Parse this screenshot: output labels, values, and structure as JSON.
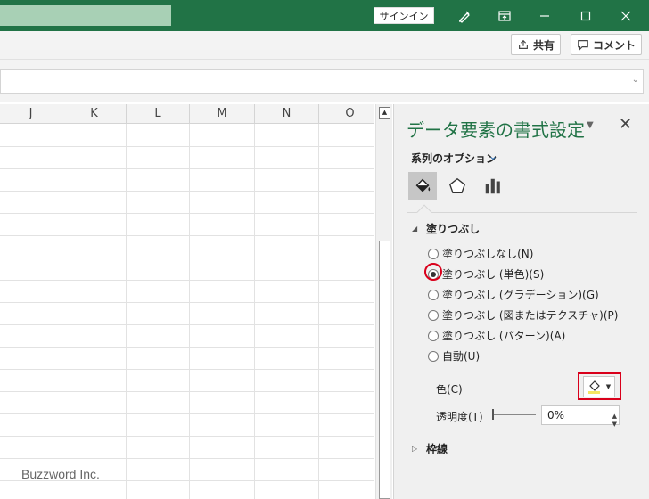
{
  "titlebar": {
    "signin_label": "サインイン"
  },
  "ribbon": {
    "share_label": "共有",
    "comment_label": "コメント"
  },
  "sheet": {
    "columns": [
      "J",
      "K",
      "L",
      "M",
      "N",
      "O"
    ],
    "watermark": "Buzzword Inc."
  },
  "pane": {
    "title": "データ要素の書式設定",
    "series_options_label": "系列のオプション",
    "tabs": [
      "fill-line-icon",
      "effects-icon",
      "series-options-icon"
    ],
    "fill_section_label": "塗りつぶし",
    "fill_options": [
      {
        "label": "塗りつぶしなし(N)",
        "checked": false
      },
      {
        "label": "塗りつぶし (単色)(S)",
        "checked": true
      },
      {
        "label": "塗りつぶし (グラデーション)(G)",
        "checked": false
      },
      {
        "label": "塗りつぶし (図またはテクスチャ)(P)",
        "checked": false
      },
      {
        "label": "塗りつぶし (パターン)(A)",
        "checked": false
      },
      {
        "label": "自動(U)",
        "checked": false
      }
    ],
    "color_label": "色(C)",
    "transparency_label": "透明度(T)",
    "transparency_value": "0%",
    "border_section_label": "枠線"
  },
  "colors": {
    "accent": "#217346",
    "highlight": "#d9001b",
    "fill_swatch": "#f5e663"
  }
}
